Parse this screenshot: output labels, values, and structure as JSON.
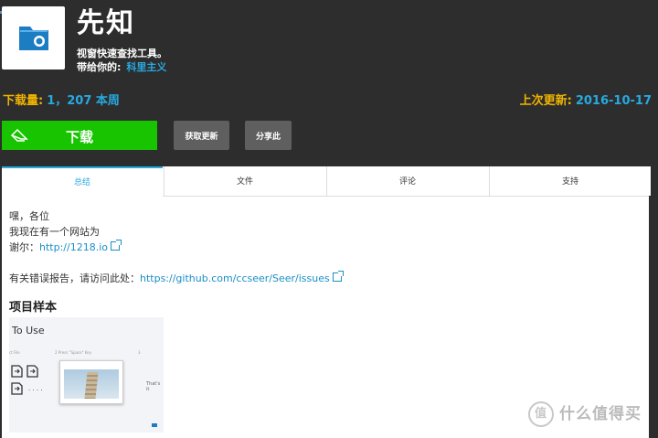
{
  "app": {
    "title": "先知",
    "description": "视窗快速查找工具。",
    "by_label": "带给你的:",
    "author": "科里主义"
  },
  "stats": {
    "downloads_label": "下载量:",
    "downloads_value": "1，207 本周",
    "last_update_label": "上次更新:",
    "last_update_value": "2016-10-17"
  },
  "buttons": {
    "download": "下载",
    "get_updates": "获取更新",
    "share": "分享此"
  },
  "tabs": [
    "总结",
    "文件",
    "评论",
    "支持"
  ],
  "summary": {
    "line1": "嘿，各位",
    "line2": "我现在有一个网站为",
    "site_label": "谢尔：",
    "site_link": "http://1218.io",
    "bug_text": "有关错误报告，请访问此处：",
    "bug_link": "https://github.com/ccseer/Seer/issues"
  },
  "samples": {
    "heading": "项目样本",
    "sample_title": "To Use",
    "sample_note1": "ct File",
    "sample_note2": "2 Press \"Space\" Key",
    "sample_note3": "3",
    "sample_note4": "That's it",
    "sample_dots": "· · · ·"
  },
  "watermark": {
    "text": "什么值得买",
    "icon_text": "值"
  },
  "colors": {
    "accent_blue": "#28a9e0",
    "label_yellow": "#f0b400",
    "download_green": "#18c400",
    "header_bg": "#2d2d2d"
  }
}
